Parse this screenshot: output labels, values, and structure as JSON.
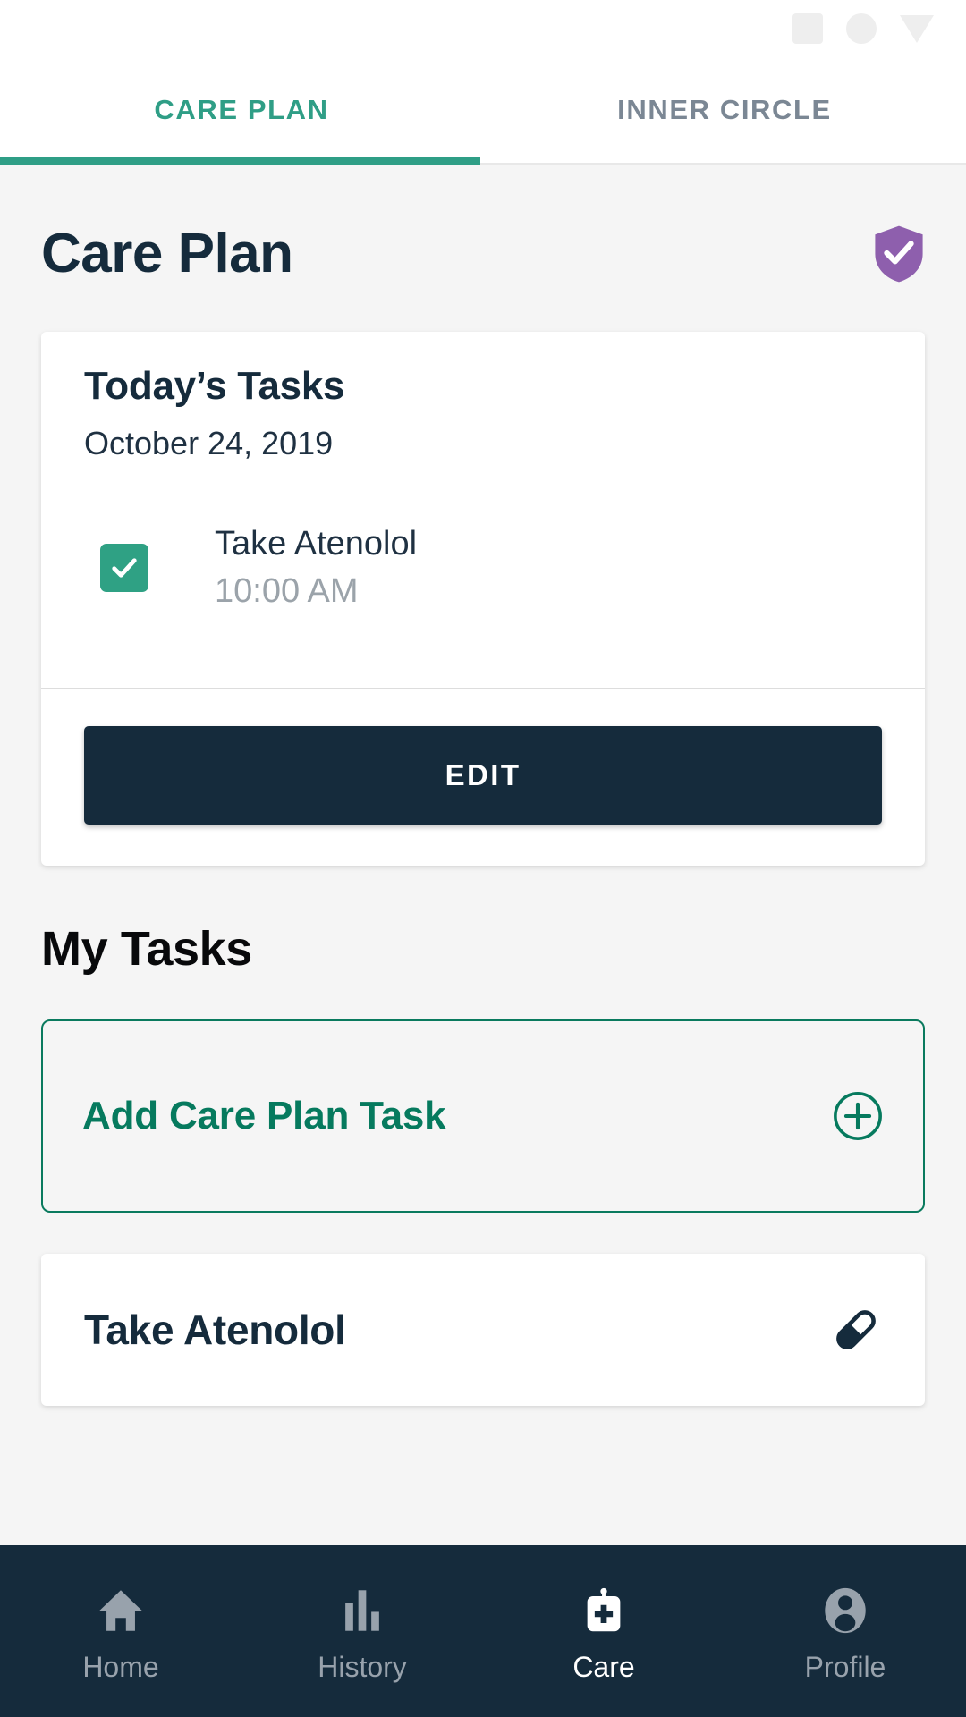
{
  "status_bar": {
    "placeholders": [
      "square-placeholder",
      "circle-placeholder",
      "triangle-placeholder"
    ]
  },
  "tabs": [
    {
      "label": "CARE PLAN",
      "active": true
    },
    {
      "label": "INNER CIRCLE",
      "active": false
    }
  ],
  "page": {
    "title": "Care Plan",
    "badge_icon": "shield-check-icon",
    "badge_color": "#8e5fad"
  },
  "todays_tasks_card": {
    "title": "Today’s Tasks",
    "date": "October 24, 2019",
    "tasks": [
      {
        "name": "Take Atenolol",
        "time": "10:00 AM",
        "checked": true,
        "checkbox_color": "#2fa184"
      }
    ],
    "edit_label": "EDIT",
    "edit_color": "#152b3c"
  },
  "my_tasks": {
    "section_title": "My Tasks",
    "add_task": {
      "label": "Add Care Plan Task",
      "icon": "plus-circle-icon",
      "accent_color": "#067a5e"
    },
    "items": [
      {
        "title": "Take Atenolol",
        "icon": "pill-icon"
      }
    ]
  },
  "bottom_nav": {
    "items": [
      {
        "label": "Home",
        "icon": "home-icon",
        "active": false
      },
      {
        "label": "History",
        "icon": "bar-chart-icon",
        "active": false
      },
      {
        "label": "Care",
        "icon": "care-bag-icon",
        "active": true
      },
      {
        "label": "Profile",
        "icon": "person-icon",
        "active": false
      }
    ],
    "background_color": "#152b3c",
    "active_color": "#ffffff",
    "inactive_color": "#98a2ac"
  },
  "theme": {
    "accent_green": "#2f9e86",
    "dark_navy": "#152b3c",
    "teal": "#067a5e",
    "purple": "#8e5fad",
    "page_bg": "#f5f5f5"
  }
}
